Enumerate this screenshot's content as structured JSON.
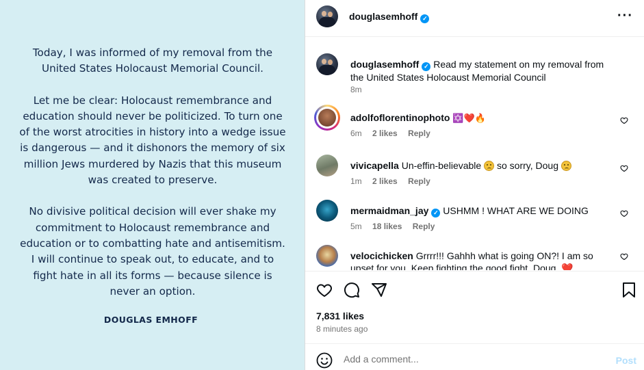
{
  "image": {
    "paragraphs": [
      "Today, I was informed of my removal from the United States Holocaust Memorial Council.",
      "Let me be clear: Holocaust remembrance and education should never be politicized. To turn one of the worst atrocities in history into a wedge issue is dangerous — and it dishonors the memory of six million Jews murdered by Nazis that this museum was created to preserve.",
      "No divisive political decision will ever shake my commitment to Holocaust remembrance and education or to combatting hate and antisemitism. I will continue to speak out, to educate, and to fight hate in all its forms — because silence is never an option."
    ],
    "signature": "DOUGLAS EMHOFF"
  },
  "header": {
    "username": "douglasemhoff",
    "more_icon": "ellipsis-icon"
  },
  "caption": {
    "username": "douglasemhoff",
    "text": "Read my statement on my removal from the United States Holocaust Memorial Council",
    "time": "8m"
  },
  "comments": [
    {
      "username": "adolfoflorentinophoto",
      "text": "✡️❤️🔥",
      "time": "6m",
      "likes": "2 likes",
      "reply": "Reply",
      "verified": false
    },
    {
      "username": "vivicapella",
      "text": "Un-effin-believable",
      "text2": "so sorry, Doug",
      "time": "1m",
      "likes": "2 likes",
      "reply": "Reply",
      "verified": false
    },
    {
      "username": "mermaidman_jay",
      "text": "USHMM ! WHAT ARE WE DOING",
      "time": "5m",
      "likes": "18 likes",
      "reply": "Reply",
      "verified": true
    },
    {
      "username": "velocichicken",
      "text": "Grrrr!!! Gahhh what is going ON?! I am so upset for you. Keep fighting the good fight, Doug. ❤️",
      "time": "",
      "likes": "",
      "reply": "",
      "verified": false
    }
  ],
  "stats": {
    "likes": "7,831 likes",
    "ago": "8 minutes ago"
  },
  "composer": {
    "placeholder": "Add a comment...",
    "post_label": "Post"
  },
  "colors": {
    "image_background": "#d6eef3",
    "statement_text": "#13284a",
    "verified": "#0095f6",
    "post_disabled": "#b2dffc",
    "heart_red": "#e03131"
  }
}
